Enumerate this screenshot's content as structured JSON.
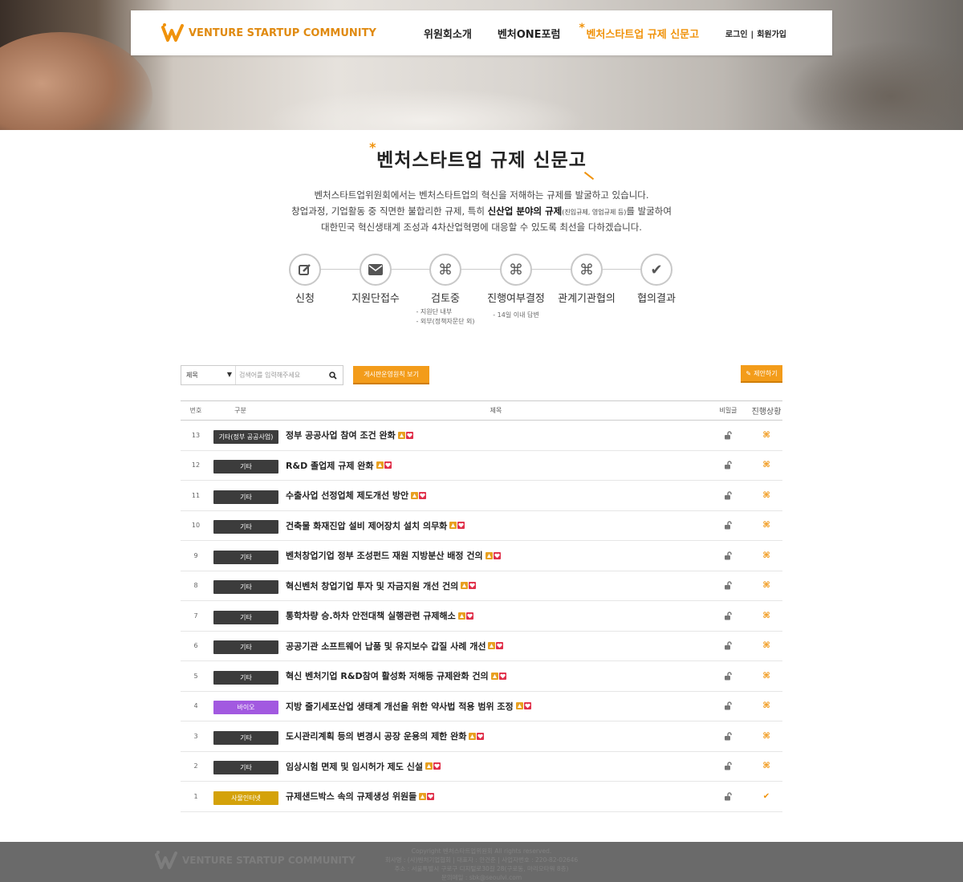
{
  "header": {
    "logo_text": "VENTURE STARTUP COMMUNITY",
    "menu": [
      {
        "label": "위원회소개",
        "active": false
      },
      {
        "label": "벤처ONE포럼",
        "active": false
      },
      {
        "label": "벤처스타트업 규제 신문고",
        "active": true
      }
    ],
    "login": "로그인",
    "separator": "|",
    "signup": "회원가입"
  },
  "page": {
    "title": "벤처스타트업 규제 신문고",
    "intro_line1": "벤처스타트업위원회에서는 벤처스타트업의 혁신을 저해하는 규제를 발굴하고 있습니다.",
    "intro_line2_a": "창업과정, 기업활동 중 직면한 불합리한 규제, 특히 ",
    "intro_line2_b": "신산업 분야의 규제",
    "intro_line2_c": "(진입규제, 영업규제 등)",
    "intro_line2_d": "를 발굴하여",
    "intro_line3": "대한민국 혁신생태계 조성과 4차산업혁명에 대응할 수 있도록 최선을 다하겠습니다."
  },
  "steps": [
    {
      "icon": "edit-icon",
      "glyph": "✎",
      "label": "신청",
      "sub": []
    },
    {
      "icon": "envelope-icon",
      "glyph": "✉",
      "label": "지원단접수",
      "sub": []
    },
    {
      "icon": "command-icon",
      "glyph": "⌘",
      "label": "검토중",
      "sub": [
        "- 지원단 내부",
        "- 외부(정책자문단 외)"
      ]
    },
    {
      "icon": "command-icon",
      "glyph": "⌘",
      "label": "진행여부결정",
      "sub": [
        "- 14일 이내 답변"
      ]
    },
    {
      "icon": "command-icon",
      "glyph": "⌘",
      "label": "관계기관협의",
      "sub": []
    },
    {
      "icon": "check-icon",
      "glyph": "✔",
      "label": "협의결과",
      "sub": []
    }
  ],
  "toolbar": {
    "search_field": "제목",
    "search_placeholder": "검색어를 입력해주세요",
    "rules_button": "게시판운영원칙 보기",
    "propose_button": "제안하기"
  },
  "table": {
    "headers": {
      "no": "번호",
      "category": "구분",
      "title": "제목",
      "secret": "비밀글",
      "status": "진행상황"
    },
    "rows": [
      {
        "no": "13",
        "category": "기타(정부 공공사업)",
        "cat_color": "#3c3c3c",
        "title": "정부 공공사업 참여 조건 완화",
        "status": "⌘"
      },
      {
        "no": "12",
        "category": "기타",
        "cat_color": "#3c3c3c",
        "title": "R&D 졸업제 규제 완화",
        "status": "⌘"
      },
      {
        "no": "11",
        "category": "기타",
        "cat_color": "#3c3c3c",
        "title": "수출사업 선정업체 제도개선 방안",
        "status": "⌘"
      },
      {
        "no": "10",
        "category": "기타",
        "cat_color": "#3c3c3c",
        "title": "건축물 화재진압 설비 제어장치 설치 의무화",
        "status": "⌘"
      },
      {
        "no": "9",
        "category": "기타",
        "cat_color": "#3c3c3c",
        "title": "벤처창업기업 정부 조성펀드 재원 지방분산 배정 건의",
        "status": "⌘"
      },
      {
        "no": "8",
        "category": "기타",
        "cat_color": "#3c3c3c",
        "title": "혁신벤처 창업기업 투자 및 자금지원 개선 건의",
        "status": "⌘"
      },
      {
        "no": "7",
        "category": "기타",
        "cat_color": "#3c3c3c",
        "title": "통학차량 승.하차 안전대책 실행관련 규제해소",
        "status": "⌘"
      },
      {
        "no": "6",
        "category": "기타",
        "cat_color": "#3c3c3c",
        "title": "공공기관 소프트웨어 납품 및 유지보수 갑질 사례 개선",
        "status": "⌘"
      },
      {
        "no": "5",
        "category": "기타",
        "cat_color": "#3c3c3c",
        "title": "혁신 벤처기업 R&D참여 활성화 저해등 규제완화 건의",
        "status": "⌘"
      },
      {
        "no": "4",
        "category": "바이오",
        "cat_color": "#a259e0",
        "title": "지방 줄기세포산업 생태계 개선을 위한 약사법 적용 범위 조정",
        "status": "⌘"
      },
      {
        "no": "3",
        "category": "기타",
        "cat_color": "#3c3c3c",
        "title": "도시관리계획 등의 변경시 공장 운용의 제한 완화",
        "status": "⌘"
      },
      {
        "no": "2",
        "category": "기타",
        "cat_color": "#3c3c3c",
        "title": "임상시험 면제 및 임시허가 제도 신설",
        "status": "⌘"
      },
      {
        "no": "1",
        "category": "사물인터넷",
        "cat_color": "#d4a20a",
        "title": "규제샌드박스 속의 규제생성 위원들",
        "status": "✔"
      }
    ]
  },
  "footer": {
    "logo_text": "VENTURE STARTUP COMMUNITY",
    "line1": "Copyright 벤처스타트업위원회 All rights reserved.",
    "line2": "회사명 : (사)벤처기업협회 | 대표자 : 안건준 | 사업자번호 : 220-82-02646",
    "line3": "주소 : 서울특별시 구로구 디지털로30길 28(구로동, 마리오타워 8층)",
    "line4": "문의메일 : sbk@seoulvi.com"
  },
  "colors": {
    "accent": "#f39c1a",
    "dark_badge": "#3c3c3c",
    "bio_badge": "#a259e0",
    "iot_badge": "#d4a20a",
    "footer_bg": "#6a6a6a"
  }
}
